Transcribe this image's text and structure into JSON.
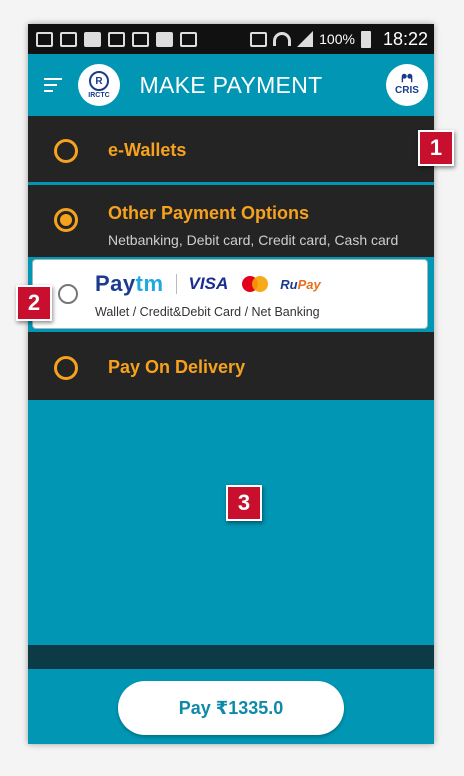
{
  "status_bar": {
    "battery": "100%",
    "time": "18:22"
  },
  "app_bar": {
    "title": "MAKE PAYMENT",
    "left_logo_text": "IRCTC",
    "right_logo_text": "CRIS"
  },
  "options": [
    {
      "label": "e-Wallets",
      "selected": false
    },
    {
      "label": "Other Payment Options",
      "subtitle": "Netbanking, Debit card, Credit card, Cash card",
      "selected": true
    },
    {
      "label": "Pay On Delivery",
      "selected": false
    }
  ],
  "paytm_option": {
    "brand_pay": "Pay",
    "brand_tm": "tm",
    "visa": "VISA",
    "rupay_ru": "Ru",
    "rupay_pay": "Pay",
    "description": "Wallet / Credit&Debit Card / Net Banking",
    "selected": false
  },
  "pay_button": {
    "label": "Pay ₹1335.0"
  },
  "callouts": [
    "1",
    "2",
    "3"
  ],
  "colors": {
    "accent": "#f6a21e",
    "primary": "#0096b4",
    "dark_row": "#242424",
    "badge": "#c8102e"
  }
}
